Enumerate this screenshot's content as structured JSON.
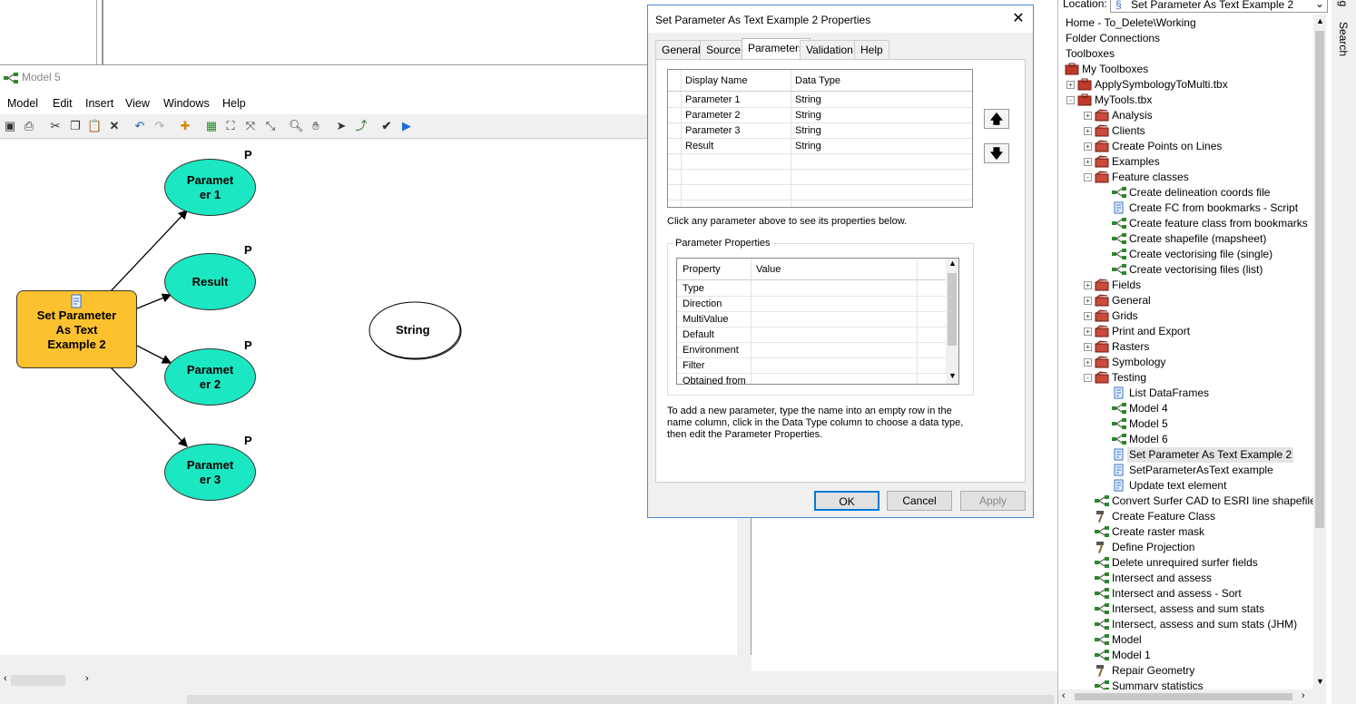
{
  "model_window": {
    "title": "Model 5",
    "menu": [
      "Model",
      "Edit",
      "Insert",
      "View",
      "Windows",
      "Help"
    ]
  },
  "diagram": {
    "tool": "Set Parameter As Text Example 2",
    "tool_lines": [
      "Set Parameter",
      "As Text",
      "Example 2"
    ],
    "outputs": [
      {
        "lines": [
          "Paramet",
          "er 1"
        ],
        "flag": "P"
      },
      {
        "lines": [
          "Result",
          ""
        ],
        "flag": "P"
      },
      {
        "lines": [
          "Paramet",
          "er 2"
        ],
        "flag": "P"
      },
      {
        "lines": [
          "Paramet",
          "er 3"
        ],
        "flag": "P"
      }
    ],
    "variable": "String"
  },
  "dialog": {
    "title": "Set Parameter As Text Example 2 Properties",
    "close": "✕",
    "tabs": [
      "General",
      "Source",
      "Parameters",
      "Validation",
      "Help"
    ],
    "active_tab": "Parameters",
    "grid": {
      "headers": [
        "Display Name",
        "Data Type"
      ],
      "rows": [
        [
          "Parameter 1",
          "String"
        ],
        [
          "Parameter 2",
          "String"
        ],
        [
          "Parameter 3",
          "String"
        ],
        [
          "Result",
          "String"
        ]
      ]
    },
    "hint": "Click any parameter above to see its properties below.",
    "properties": {
      "legend": "Parameter Properties",
      "headers": [
        "Property",
        "Value"
      ],
      "rows": [
        "Type",
        "Direction",
        "MultiValue",
        "Default",
        "Environment",
        "Filter",
        "Obtained from"
      ]
    },
    "note": "To add a new parameter, type the name into an empty row in the name column, click in the Data Type column to choose a data type, then edit the Parameter Properties.",
    "buttons": {
      "ok": "OK",
      "cancel": "Cancel",
      "apply": "Apply"
    }
  },
  "catalog": {
    "location_label": "Location:",
    "location_value": "Set Parameter As Text Example 2",
    "side_tabs": [
      "og",
      "Search"
    ],
    "tree": [
      {
        "label": "Home - To_Delete\\Working",
        "level": 0,
        "icon": "none",
        "exp": ""
      },
      {
        "label": "Folder Connections",
        "level": 0,
        "icon": "none",
        "exp": ""
      },
      {
        "label": "Toolboxes",
        "level": 0,
        "icon": "none",
        "exp": ""
      },
      {
        "label": "My Toolboxes",
        "level": 0,
        "icon": "toolbox",
        "exp": ""
      },
      {
        "label": "ApplySymbologyToMulti.tbx",
        "level": 1,
        "icon": "toolbox",
        "exp": "+"
      },
      {
        "label": "MyTools.tbx",
        "level": 1,
        "icon": "toolbox",
        "exp": "-"
      },
      {
        "label": "Analysis",
        "level": 2,
        "icon": "toolset",
        "exp": "+"
      },
      {
        "label": "Clients",
        "level": 2,
        "icon": "toolset",
        "exp": "+"
      },
      {
        "label": "Create Points on Lines",
        "level": 2,
        "icon": "toolset",
        "exp": "+"
      },
      {
        "label": "Examples",
        "level": 2,
        "icon": "toolset",
        "exp": "+"
      },
      {
        "label": "Feature classes",
        "level": 2,
        "icon": "toolset",
        "exp": "-"
      },
      {
        "label": "Create delineation coords file",
        "level": 3,
        "icon": "model",
        "exp": ""
      },
      {
        "label": "Create FC from bookmarks - Script",
        "level": 3,
        "icon": "script",
        "exp": ""
      },
      {
        "label": "Create feature class from bookmarks",
        "level": 3,
        "icon": "model",
        "exp": ""
      },
      {
        "label": "Create shapefile (mapsheet)",
        "level": 3,
        "icon": "model",
        "exp": ""
      },
      {
        "label": "Create vectorising file (single)",
        "level": 3,
        "icon": "model",
        "exp": ""
      },
      {
        "label": "Create vectorising files (list)",
        "level": 3,
        "icon": "model",
        "exp": ""
      },
      {
        "label": "Fields",
        "level": 2,
        "icon": "toolset",
        "exp": "+"
      },
      {
        "label": "General",
        "level": 2,
        "icon": "toolset",
        "exp": "+"
      },
      {
        "label": "Grids",
        "level": 2,
        "icon": "toolset",
        "exp": "+"
      },
      {
        "label": "Print and Export",
        "level": 2,
        "icon": "toolset",
        "exp": "+"
      },
      {
        "label": "Rasters",
        "level": 2,
        "icon": "toolset",
        "exp": "+"
      },
      {
        "label": "Symbology",
        "level": 2,
        "icon": "toolset",
        "exp": "+"
      },
      {
        "label": "Testing",
        "level": 2,
        "icon": "toolset",
        "exp": "-"
      },
      {
        "label": "List DataFrames",
        "level": 3,
        "icon": "script",
        "exp": ""
      },
      {
        "label": "Model 4",
        "level": 3,
        "icon": "model",
        "exp": ""
      },
      {
        "label": "Model 5",
        "level": 3,
        "icon": "model",
        "exp": ""
      },
      {
        "label": "Model 6",
        "level": 3,
        "icon": "model",
        "exp": ""
      },
      {
        "label": "Set Parameter As Text Example 2",
        "level": 3,
        "icon": "script",
        "exp": "",
        "selected": true
      },
      {
        "label": "SetParameterAsText example",
        "level": 3,
        "icon": "script",
        "exp": ""
      },
      {
        "label": "Update text element",
        "level": 3,
        "icon": "script",
        "exp": ""
      },
      {
        "label": "Convert Surfer CAD to ESRI line shapefile",
        "level": 2,
        "icon": "model",
        "exp": ""
      },
      {
        "label": "Create Feature Class",
        "level": 2,
        "icon": "hammer",
        "exp": ""
      },
      {
        "label": "Create raster mask",
        "level": 2,
        "icon": "model",
        "exp": ""
      },
      {
        "label": "Define Projection",
        "level": 2,
        "icon": "hammer",
        "exp": ""
      },
      {
        "label": "Delete unrequired surfer fields",
        "level": 2,
        "icon": "model",
        "exp": ""
      },
      {
        "label": "Intersect and assess",
        "level": 2,
        "icon": "model",
        "exp": ""
      },
      {
        "label": "Intersect and assess - Sort",
        "level": 2,
        "icon": "model",
        "exp": ""
      },
      {
        "label": "Intersect, assess and sum stats",
        "level": 2,
        "icon": "model",
        "exp": ""
      },
      {
        "label": "Intersect, assess and sum stats (JHM)",
        "level": 2,
        "icon": "model",
        "exp": ""
      },
      {
        "label": "Model",
        "level": 2,
        "icon": "model",
        "exp": ""
      },
      {
        "label": "Model 1",
        "level": 2,
        "icon": "model",
        "exp": ""
      },
      {
        "label": "Repair Geometry",
        "level": 2,
        "icon": "hammer",
        "exp": ""
      },
      {
        "label": "Summary statistics",
        "level": 2,
        "icon": "model",
        "exp": ""
      }
    ]
  },
  "colors": {
    "oval": "#1be7c2",
    "tool": "#fcc12e",
    "selection": "#e5e5e5",
    "dialog_border": "#4a8ad6"
  }
}
